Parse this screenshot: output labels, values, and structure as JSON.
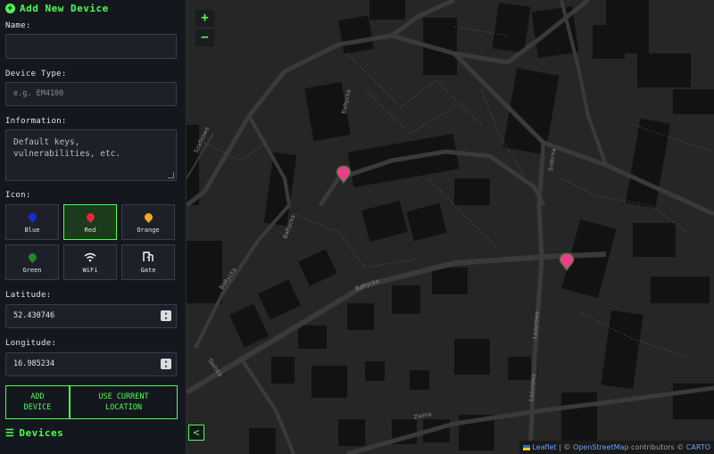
{
  "form": {
    "title": "Add New Device",
    "name_label": "Name:",
    "name_value": "",
    "type_label": "Device Type:",
    "type_placeholder": "e.g. EM4100",
    "info_label": "Information:",
    "info_placeholder_line1": "Default keys,",
    "info_placeholder_line2": "vulnerabilities, etc.",
    "icon_label": "Icon:",
    "icons": [
      {
        "label": "Blue",
        "icon": "blue-pin-icon",
        "color": "#1a2ad6",
        "selected": false
      },
      {
        "label": "Red",
        "icon": "red-pin-icon",
        "color": "#e8263f",
        "selected": true
      },
      {
        "label": "Orange",
        "icon": "orange-pin-icon",
        "color": "#f5a623",
        "selected": false
      },
      {
        "label": "Green",
        "icon": "green-pin-icon",
        "color": "#1e8a2a",
        "selected": false
      },
      {
        "label": "WiFi",
        "icon": "wifi-icon",
        "color": "#ffffff",
        "selected": false
      },
      {
        "label": "Gate",
        "icon": "gate-icon",
        "color": "#ffffff",
        "selected": false
      }
    ],
    "lat_label": "Latitude:",
    "lat_value": "52.430746",
    "lon_label": "Longitude:",
    "lon_value": "16.985234",
    "add_line1": "ADD",
    "add_line2": "DEVICE",
    "loc_line1": "USE CURRENT",
    "loc_line2": "LOCATION"
  },
  "devices": {
    "title": "Devices"
  },
  "map": {
    "zoom_in": "+",
    "zoom_out": "−",
    "collapse": "<",
    "attribution_leaflet": "Leaflet",
    "attribution_sep": " | © ",
    "attribution_osm": "OpenStreetMap",
    "attribution_mid": " contributors © ",
    "attribution_carto": "CARTO",
    "streets": [
      "Bałtycka",
      "Bałtycka",
      "Bałtycka",
      "Lazurowa",
      "Lazurowa",
      "Srebrna",
      "Sielska",
      "Zielna",
      "Bałtycka",
      "Szafirowa"
    ],
    "marker_color": "#ea3f8a"
  },
  "colors": {
    "accent": "#4cff4c",
    "panel": "#15171f"
  }
}
